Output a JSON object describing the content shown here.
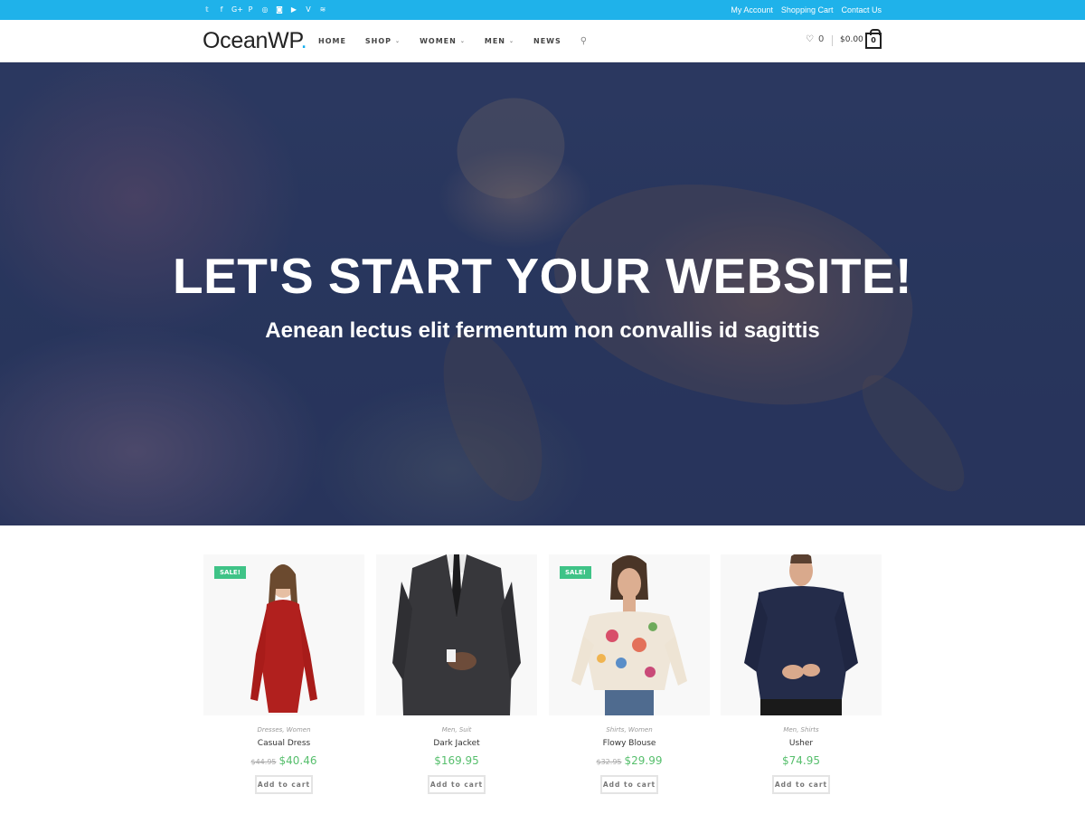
{
  "topbar": {
    "bg_color": "#1fb2ea",
    "social_icons": [
      {
        "name": "twitter-icon",
        "glyph": "𝕥"
      },
      {
        "name": "facebook-icon",
        "glyph": "f"
      },
      {
        "name": "google-plus-icon",
        "glyph": "G+"
      },
      {
        "name": "pinterest-icon",
        "glyph": "P"
      },
      {
        "name": "dribbble-icon",
        "glyph": "◎"
      },
      {
        "name": "instagram-icon",
        "glyph": "◙"
      },
      {
        "name": "youtube-icon",
        "glyph": "▶"
      },
      {
        "name": "vimeo-icon",
        "glyph": "V"
      },
      {
        "name": "rss-icon",
        "glyph": "≋"
      }
    ],
    "links": [
      "My Account",
      "Shopping Cart",
      "Contact Us"
    ]
  },
  "header": {
    "logo_text": "OceanWP",
    "logo_dot": ".",
    "nav": [
      {
        "label": "HOME",
        "dropdown": false
      },
      {
        "label": "SHOP",
        "dropdown": true
      },
      {
        "label": "WOMEN",
        "dropdown": true
      },
      {
        "label": "MEN",
        "dropdown": true
      },
      {
        "label": "NEWS",
        "dropdown": false
      }
    ],
    "wishlist_count": "0",
    "cart_total": "$0.00",
    "cart_count": "0",
    "accent_color": "#13aff0"
  },
  "hero": {
    "title": "LET'S START YOUR WEBSITE!",
    "subtitle": "Aenean lectus elit fermentum non convallis id sagittis"
  },
  "products": [
    {
      "sale": true,
      "sale_label": "SALE!",
      "categories": "Dresses, Women",
      "name": "Casual Dress",
      "old_price": "$44.95",
      "price": "$40.46",
      "button": "Add to cart"
    },
    {
      "sale": false,
      "sale_label": "",
      "categories": "Men, Suit",
      "name": "Dark Jacket",
      "old_price": "",
      "price": "$169.95",
      "button": "Add to cart"
    },
    {
      "sale": true,
      "sale_label": "SALE!",
      "categories": "Shirts, Women",
      "name": "Flowy Blouse",
      "old_price": "$32.95",
      "price": "$29.99",
      "button": "Add to cart"
    },
    {
      "sale": false,
      "sale_label": "",
      "categories": "Men, Shirts",
      "name": "Usher",
      "old_price": "",
      "price": "$74.95",
      "button": "Add to cart"
    }
  ],
  "colors": {
    "sale_badge": "#3fc387",
    "price": "#57bf6d"
  }
}
